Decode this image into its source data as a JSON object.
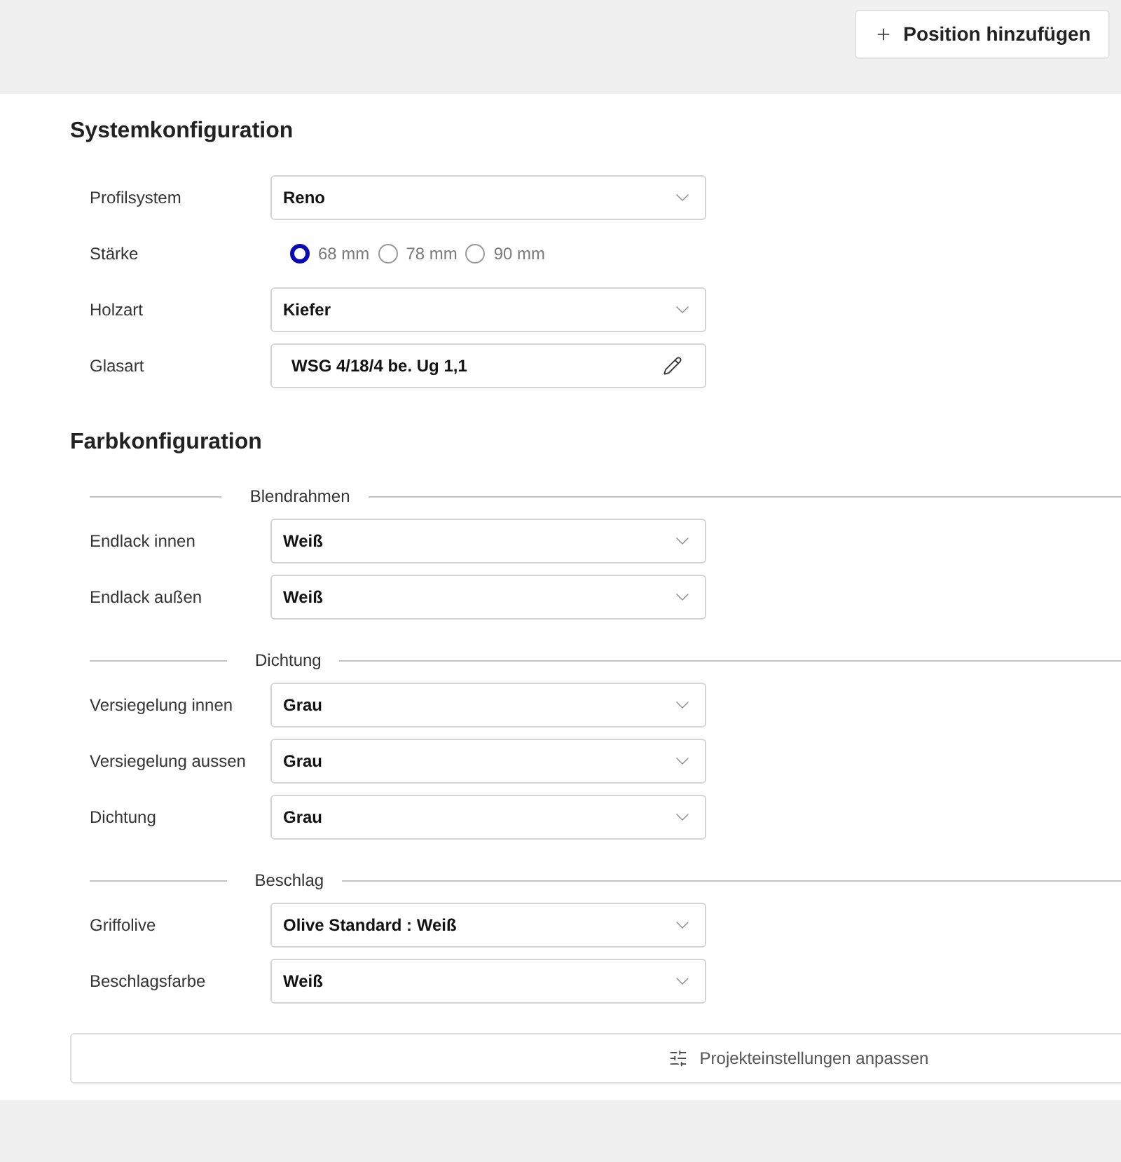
{
  "header": {
    "add_button": {
      "label": "Position hinzufügen"
    }
  },
  "sections": [
    {
      "title": "Systemkonfiguration",
      "groups": [
        {
          "fields": [
            {
              "kind": "select",
              "label": "Profilsystem",
              "value": "Reno"
            },
            {
              "kind": "radio",
              "label": "Stärke",
              "options": [
                {
                  "label": "68 mm",
                  "selected": true
                },
                {
                  "label": "78 mm",
                  "selected": false
                },
                {
                  "label": "90 mm",
                  "selected": false
                }
              ]
            },
            {
              "kind": "select",
              "label": "Holzart",
              "value": "Kiefer"
            },
            {
              "kind": "edit",
              "label": "Glasart",
              "value": "WSG 4/18/4 be. Ug 1,1"
            }
          ]
        }
      ]
    },
    {
      "title": "Farbkonfiguration",
      "groups": [
        {
          "title": "Blendrahmen",
          "fields": [
            {
              "kind": "select",
              "label": "Endlack innen",
              "value": "Weiß"
            },
            {
              "kind": "select",
              "label": "Endlack außen",
              "value": "Weiß"
            }
          ]
        },
        {
          "title": "Dichtung",
          "fields": [
            {
              "kind": "select",
              "label": "Versiegelung innen",
              "value": "Grau"
            },
            {
              "kind": "select",
              "label": "Versiegelung aussen",
              "value": "Grau"
            },
            {
              "kind": "select",
              "label": "Dichtung",
              "value": "Grau"
            }
          ]
        },
        {
          "title": "Beschlag",
          "fields": [
            {
              "kind": "select",
              "label": "Griffolive",
              "value": "Olive Standard : Weiß"
            },
            {
              "kind": "select",
              "label": "Beschlagsfarbe",
              "value": "Weiß"
            }
          ]
        }
      ]
    }
  ],
  "footer_button": {
    "label": "Projekteinstellungen anpassen"
  }
}
